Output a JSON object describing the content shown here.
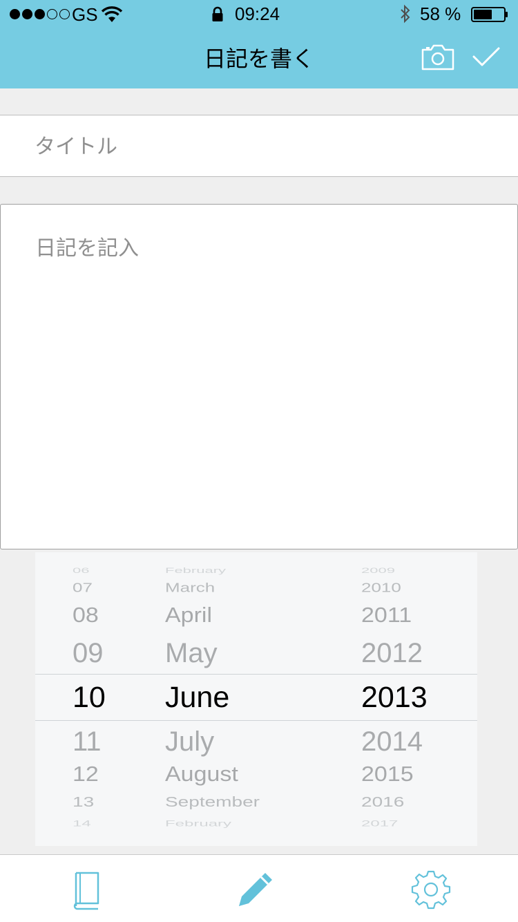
{
  "status_bar": {
    "carrier": "GS",
    "time": "09:24",
    "battery": "58 %"
  },
  "header": {
    "title": "日記を書く",
    "icons": [
      "camera-icon",
      "check-icon"
    ]
  },
  "form": {
    "title_placeholder": "タイトル",
    "body_placeholder": "日記を記入"
  },
  "date_picker": {
    "rows": [
      {
        "day": "06",
        "month": "February",
        "year": "2009"
      },
      {
        "day": "07",
        "month": "March",
        "year": "2010"
      },
      {
        "day": "08",
        "month": "April",
        "year": "2011"
      },
      {
        "day": "09",
        "month": "May",
        "year": "2012"
      },
      {
        "day": "10",
        "month": "June",
        "year": "2013"
      },
      {
        "day": "11",
        "month": "July",
        "year": "2014"
      },
      {
        "day": "12",
        "month": "August",
        "year": "2015"
      },
      {
        "day": "13",
        "month": "September",
        "year": "2016"
      },
      {
        "day": "14",
        "month": "February",
        "year": "2017"
      }
    ],
    "selected": {
      "day": "10",
      "month": "June",
      "year": "2013"
    }
  },
  "tab_bar": {
    "icons": [
      "book-icon",
      "pencil-icon",
      "gear-icon"
    ]
  },
  "colors": {
    "header": "#76cce2",
    "accent_icon": "#62c1da",
    "background": "#efefef"
  }
}
